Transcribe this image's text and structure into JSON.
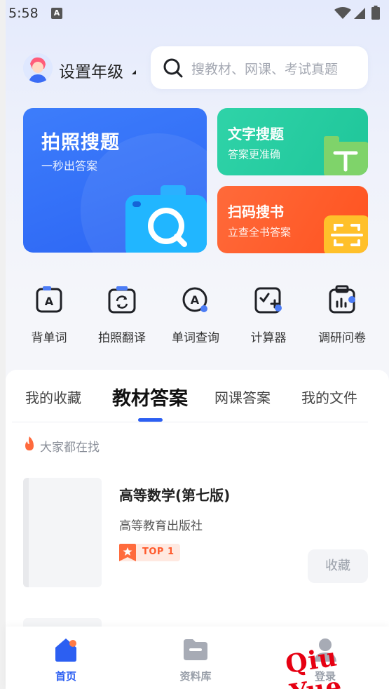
{
  "status_bar": {
    "time": "5:58",
    "notification_icon": "A"
  },
  "header": {
    "grade_label": "设置年级",
    "search": {
      "placeholder": "搜教材、网课、考试真题"
    }
  },
  "feature_cards": {
    "photo_search": {
      "title": "拍照搜题",
      "subtitle": "一秒出答案",
      "color": "#2f6cf6"
    },
    "text_search": {
      "title": "文字搜题",
      "subtitle": "答案更准确",
      "color": "#22cc9f"
    },
    "scan_book": {
      "title": "扫码搜书",
      "subtitle": "立查全书答案",
      "color": "#ff5a26"
    }
  },
  "tools": [
    {
      "label": "背单词",
      "icon": "flashcard-a-icon"
    },
    {
      "label": "拍照翻译",
      "icon": "photo-translate-icon"
    },
    {
      "label": "单词查询",
      "icon": "word-lookup-icon"
    },
    {
      "label": "计算器",
      "icon": "calculator-icon"
    },
    {
      "label": "调研问卷",
      "icon": "survey-clipboard-icon"
    }
  ],
  "tabs": [
    {
      "label": "我的收藏",
      "active": false
    },
    {
      "label": "教材答案",
      "active": true
    },
    {
      "label": "网课答案",
      "active": false
    },
    {
      "label": "我的文件",
      "active": false
    }
  ],
  "hot_section": {
    "label": "大家都在找"
  },
  "books": [
    {
      "title": "高等数学(第七版)",
      "publisher": "高等教育出版社",
      "badge": "TOP 1",
      "action": "收藏"
    }
  ],
  "bottom_nav": [
    {
      "label": "首页",
      "icon": "home-icon",
      "active": true
    },
    {
      "label": "资料库",
      "icon": "folder-icon",
      "active": false
    },
    {
      "label": "登录",
      "icon": "user-icon",
      "active": false
    }
  ],
  "watermark": "Qiu Yue",
  "accent_color": "#2c5ff2"
}
